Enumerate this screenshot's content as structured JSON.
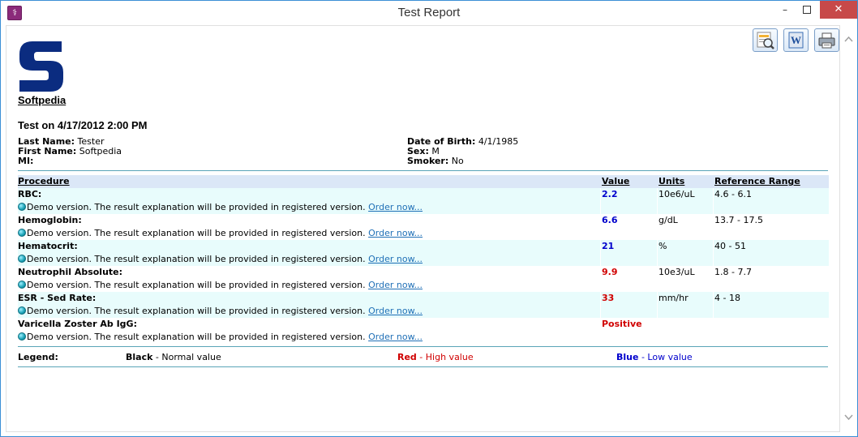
{
  "window": {
    "title": "Test Report",
    "min_label": "–",
    "max_label": "▫",
    "close_label": "✕"
  },
  "toolbar": {
    "icons": [
      "print-preview-icon",
      "word-export-icon",
      "printer-icon"
    ]
  },
  "brand": {
    "logo_letter": "S",
    "name": "Softpedia",
    "logo_color": "#0b2c80"
  },
  "report": {
    "title": "Test on 4/17/2012 2:00 PM"
  },
  "patient": {
    "last_name_label": "Last Name:",
    "last_name": "Tester",
    "first_name_label": "First Name:",
    "first_name": "Softpedia",
    "mi_label": "MI:",
    "mi": "",
    "dob_label": "Date of Birth:",
    "dob": "4/1/1985",
    "sex_label": "Sex:",
    "sex": "M",
    "smoker_label": "Smoker:",
    "smoker": "No"
  },
  "table": {
    "headers": {
      "procedure": "Procedure",
      "value": "Value",
      "units": "Units",
      "reference": "Reference Range"
    },
    "demo_text": "Demo version. The result explanation will be provided in registered version.",
    "order_link": "Order now...",
    "rows": [
      {
        "name": "RBC:",
        "value": "2.2",
        "units": "10e6/uL",
        "range": "4.6 - 6.1",
        "status": "low"
      },
      {
        "name": "Hemoglobin:",
        "value": "6.6",
        "units": "g/dL",
        "range": "13.7 - 17.5",
        "status": "low"
      },
      {
        "name": "Hematocrit:",
        "value": "21",
        "units": "%",
        "range": "40 - 51",
        "status": "low"
      },
      {
        "name": "Neutrophil Absolute:",
        "value": "9.9",
        "units": "10e3/uL",
        "range": "1.8 - 7.7",
        "status": "high"
      },
      {
        "name": "ESR - Sed Rate:",
        "value": "33",
        "units": "mm/hr",
        "range": "4 - 18",
        "status": "high"
      },
      {
        "name": "Varicella Zoster Ab IgG:",
        "value": "Positive",
        "units": "",
        "range": "",
        "status": "high"
      }
    ]
  },
  "legend": {
    "title": "Legend:",
    "black_word": "Black",
    "black_text": " - Normal value",
    "red_word": "Red",
    "red_text": " - High value",
    "blue_word": "Blue",
    "blue_text": " - Low value",
    "colors": {
      "normal": "#000000",
      "high": "#d00000",
      "low": "#0000cc"
    }
  }
}
